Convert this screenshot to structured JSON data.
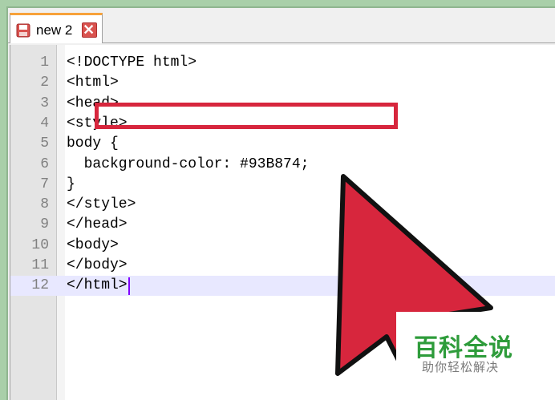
{
  "tab": {
    "label": "new 2"
  },
  "editor": {
    "current_line": 12,
    "lines": [
      {
        "num": "1",
        "code": "<!DOCTYPE html>"
      },
      {
        "num": "2",
        "code": "<html>"
      },
      {
        "num": "3",
        "code": "<head>"
      },
      {
        "num": "4",
        "code": "<style>"
      },
      {
        "num": "5",
        "code": "body {"
      },
      {
        "num": "6",
        "code": "  background-color: #93B874;"
      },
      {
        "num": "7",
        "code": "}"
      },
      {
        "num": "8",
        "code": "</style>"
      },
      {
        "num": "9",
        "code": "</head>"
      },
      {
        "num": "10",
        "code": "<body>"
      },
      {
        "num": "11",
        "code": "</body>"
      },
      {
        "num": "12",
        "code": "</html>"
      }
    ]
  },
  "annotation": {
    "highlight_color": "#d7263d",
    "arrow_color": "#d7263d",
    "icon": "pointer-arrow-icon"
  },
  "watermark": {
    "main": "百科全说",
    "sub": "助你轻松解决",
    "color": "#2e9c3b"
  },
  "colors": {
    "background": "#a9cfa9",
    "tab_accent": "#f7a23a",
    "caret": "#8000ff"
  }
}
